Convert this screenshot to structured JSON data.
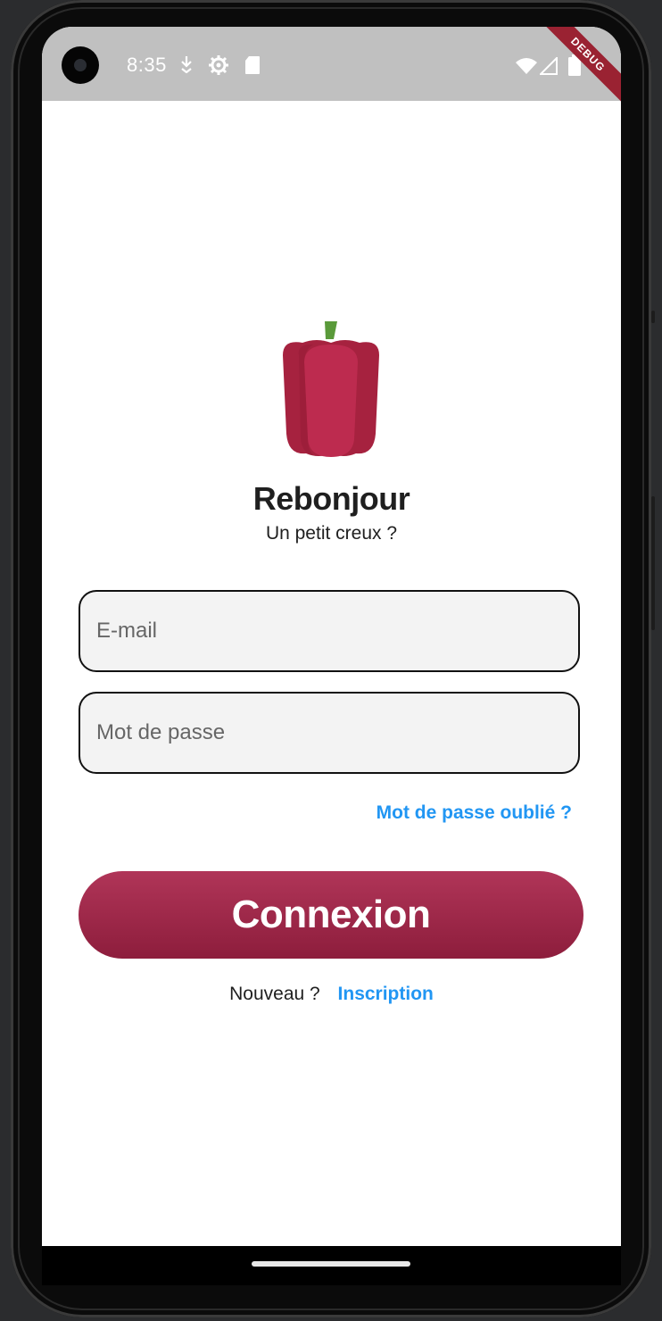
{
  "status_bar": {
    "time": "8:35",
    "debug_banner": "DEBUG"
  },
  "header": {
    "title": "Rebonjour",
    "subtitle": "Un petit creux ?"
  },
  "form": {
    "email_placeholder": "E-mail",
    "password_placeholder": "Mot de passe",
    "forgot_password": "Mot de passe oublié ?",
    "login_button": "Connexion"
  },
  "signup": {
    "prompt": "Nouveau ?",
    "link": "Inscription"
  },
  "icons": {
    "logo": "bell-pepper-icon",
    "status": [
      "download-arrow-icon",
      "settings-gear-icon",
      "sd-card-icon",
      "wifi-icon",
      "signal-icon",
      "battery-icon"
    ]
  },
  "colors": {
    "accent": "#2196f3",
    "button_top": "#b03558",
    "button_bottom": "#8d1d3c",
    "pepper": "#b82a4c",
    "stem": "#5a9a3a"
  }
}
